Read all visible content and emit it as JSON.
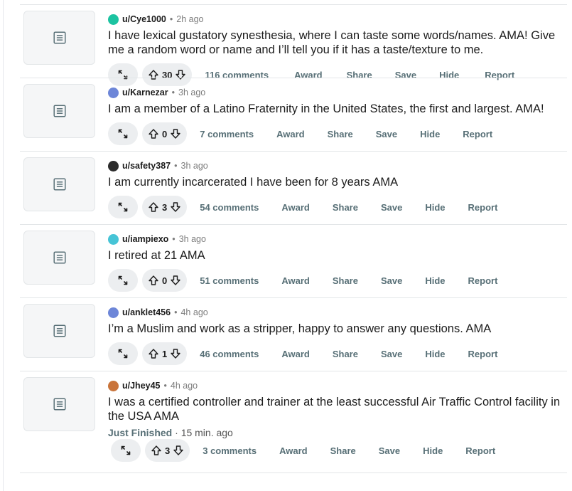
{
  "posts": [
    {
      "user": "u/Cye1000",
      "time": "2h ago",
      "title": "I have lexical gustatory synesthesia, where I can taste some words/names. AMA! Give me a random word or name and I’ll tell you if it has a taste/texture to me.",
      "votes": "30",
      "comments": "116 comments",
      "avatar_color": "#1cc3a1",
      "avatar_icon": "snoo-avatar-icon"
    },
    {
      "user": "u/Karnezar",
      "time": "3h ago",
      "title": "I am a member of a Latino Fraternity in the United States, the first and largest. AMA!",
      "votes": "0",
      "comments": "7 comments",
      "avatar_color": "#6d86d8",
      "avatar_icon": "snoo-avatar-icon"
    },
    {
      "user": "u/safety387",
      "time": "3h ago",
      "title": "I am currently incarcerated I have been for 8 years AMA",
      "votes": "3",
      "comments": "54 comments",
      "avatar_color": "#2b2b2b",
      "avatar_icon": "snoo-avatar-icon"
    },
    {
      "user": "u/iampiexo",
      "time": "3h ago",
      "title": "I retired at 21 AMA",
      "votes": "0",
      "comments": "51 comments",
      "avatar_color": "#46c4d6",
      "avatar_icon": "snoo-avatar-icon"
    },
    {
      "user": "u/anklet456",
      "time": "4h ago",
      "title": "I’m a Muslim and work as a stripper, happy to answer any questions. AMA",
      "votes": "1",
      "comments": "46 comments",
      "avatar_color": "#6d86d8",
      "avatar_icon": "snoo-avatar-icon"
    },
    {
      "user": "u/Jhey45",
      "time": "4h ago",
      "title": "I was a certified controller and trainer at the least successful Air Traffic Control facility in the USA AMA",
      "status_label": "Just Finished",
      "status_time": "15 min. ago",
      "votes": "3",
      "comments": "3 comments",
      "avatar_color": "#c9743a",
      "avatar_icon": "snoo-avatar-icon"
    }
  ],
  "actions": {
    "award": "Award",
    "share": "Share",
    "save": "Save",
    "hide": "Hide",
    "report": "Report"
  },
  "icons": {
    "thumbnail": "text-post-icon",
    "expand": "expand-arrows-icon",
    "upvote": "upvote-arrow-icon",
    "downvote": "downvote-arrow-icon"
  },
  "colors": {
    "text": "#1c1c1c",
    "muted": "#7c7c7c",
    "action": "#576f76",
    "pill_bg": "#eceef0",
    "divider": "#e3e6e8"
  }
}
